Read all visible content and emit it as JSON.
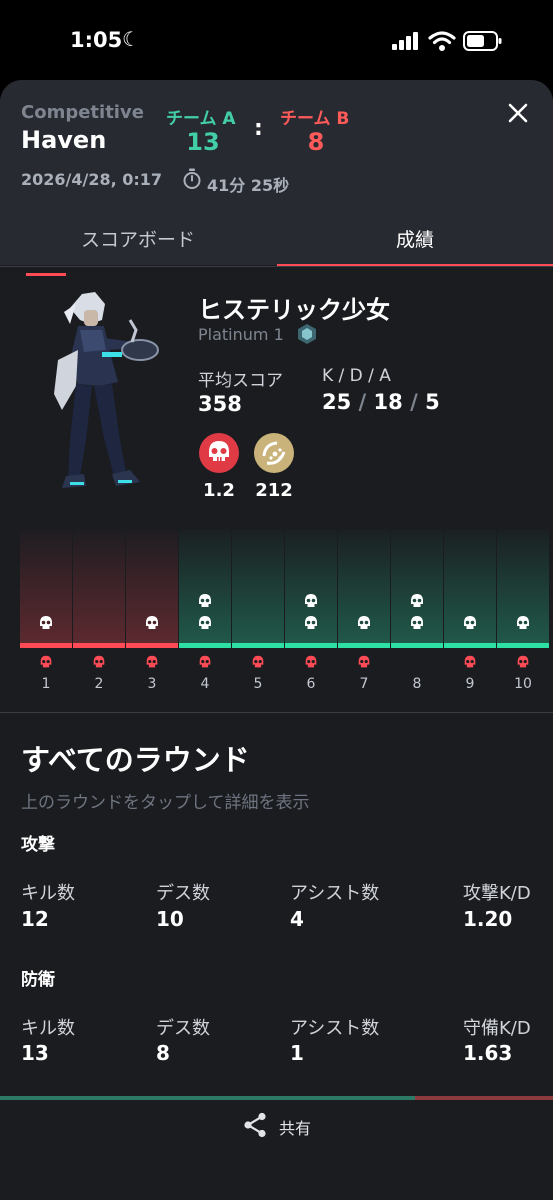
{
  "status": {
    "time": "1:05"
  },
  "header": {
    "mode": "Competitive",
    "map": "Haven",
    "date": "2026/4/28, 0:17",
    "duration": "41分 25秒",
    "team_a": {
      "label": "チーム A",
      "score": "13",
      "color": "#42cfa8"
    },
    "team_b": {
      "label": "チーム B",
      "score": "8",
      "color": "#ff5a5a"
    },
    "colon": ":"
  },
  "tabs": [
    {
      "label": "スコアボード",
      "active": false
    },
    {
      "label": "成績",
      "active": true
    }
  ],
  "player": {
    "name": "ヒステリック少女",
    "rank": "Platinum 1",
    "avg_score_label": "平均スコア",
    "avg_score": "358",
    "kda_label": "K / D / A",
    "kills": "25",
    "deaths": "18",
    "assists": "5",
    "kda_sep": "/",
    "badge_red_value": "1.2",
    "badge_gold_value": "212"
  },
  "rounds": [
    {
      "num": "1",
      "result": "loss",
      "kills": 1,
      "died": true
    },
    {
      "num": "2",
      "result": "loss",
      "kills": 0,
      "died": true
    },
    {
      "num": "3",
      "result": "loss",
      "kills": 1,
      "died": true
    },
    {
      "num": "4",
      "result": "win",
      "kills": 2,
      "died": true
    },
    {
      "num": "5",
      "result": "win",
      "kills": 0,
      "died": true
    },
    {
      "num": "6",
      "result": "win",
      "kills": 2,
      "died": true
    },
    {
      "num": "7",
      "result": "win",
      "kills": 1,
      "died": true
    },
    {
      "num": "8",
      "result": "win",
      "kills": 2,
      "died": false
    },
    {
      "num": "9",
      "result": "win",
      "kills": 1,
      "died": true
    },
    {
      "num": "10",
      "result": "win",
      "kills": 1,
      "died": true
    }
  ],
  "all_rounds": {
    "title": "すべてのラウンド",
    "subtitle": "上のラウンドをタップして詳細を表示",
    "attack": {
      "label": "攻撃",
      "kills_label": "キル数",
      "kills": "12",
      "deaths_label": "デス数",
      "deaths": "10",
      "assists_label": "アシスト数",
      "assists": "4",
      "kd_label": "攻撃K/D",
      "kd": "1.20"
    },
    "defense": {
      "label": "防衛",
      "kills_label": "キル数",
      "kills": "13",
      "deaths_label": "デス数",
      "deaths": "8",
      "assists_label": "アシスト数",
      "assists": "1",
      "kd_label": "守備K/D",
      "kd": "1.63"
    }
  },
  "share": {
    "label": "共有"
  },
  "colors": {
    "win": "#2ee0a4",
    "loss": "#ff4b55",
    "accent": "#ff4b55"
  }
}
